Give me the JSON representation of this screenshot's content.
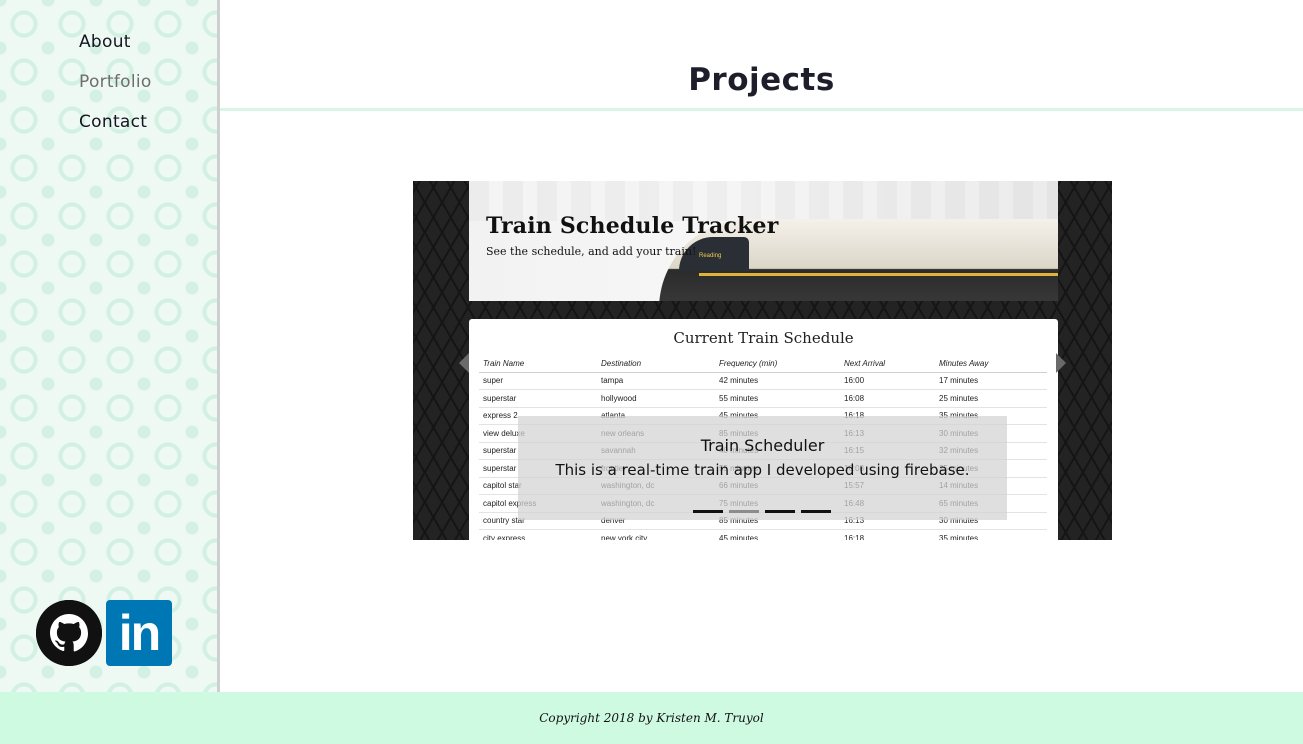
{
  "sidebar": {
    "nav": [
      {
        "label": "About",
        "active": false
      },
      {
        "label": "Portfolio",
        "active": true
      },
      {
        "label": "Contact",
        "active": false
      }
    ],
    "social": [
      {
        "name": "github-icon"
      },
      {
        "name": "linkedin-icon",
        "text": "in"
      }
    ]
  },
  "header": {
    "title": "Projects"
  },
  "carousel": {
    "slide": {
      "hero_title": "Train Schedule Tracker",
      "hero_subtitle": "See the schedule, and add your train!",
      "train_sign": "Reading",
      "table_title": "Current Train Schedule",
      "columns": [
        "Train Name",
        "Destination",
        "Frequency (min)",
        "Next Arrival",
        "Minutes Away"
      ],
      "rows": [
        [
          "super",
          "tampa",
          "42 minutes",
          "16:00",
          "17 minutes"
        ],
        [
          "superstar",
          "hollywood",
          "55 minutes",
          "16:08",
          "25 minutes"
        ],
        [
          "express 2",
          "atlanta",
          "45 minutes",
          "16:18",
          "35 minutes"
        ],
        [
          "view deluxe",
          "new orleans",
          "85 minutes",
          "16:13",
          "30 minutes"
        ],
        [
          "superstar",
          "savannah",
          "40 minutes",
          "16:15",
          "32 minutes"
        ],
        [
          "superstar",
          "frontier",
          "55 minutes",
          "16:08",
          "25 minutes"
        ],
        [
          "capitol star",
          "washington, dc",
          "66 minutes",
          "15:57",
          "14 minutes"
        ],
        [
          "capitol express",
          "washington, dc",
          "75 minutes",
          "16:48",
          "65 minutes"
        ],
        [
          "country star",
          "denver",
          "85 minutes",
          "16:13",
          "30 minutes"
        ],
        [
          "city express",
          "new york city",
          "45 minutes",
          "16:18",
          "35 minutes"
        ]
      ]
    },
    "caption": {
      "title": "Train Scheduler",
      "text": "This is a real-time train app I developed using firebase."
    },
    "indicators": [
      false,
      true,
      false,
      false
    ]
  },
  "footer": {
    "copyright": "Copyright 2018 by Kristen M. Truyol"
  },
  "colors": {
    "footer_bg": "#cffae2",
    "linkedin": "#0077b5",
    "accent_rule": "#d7f6e6"
  }
}
